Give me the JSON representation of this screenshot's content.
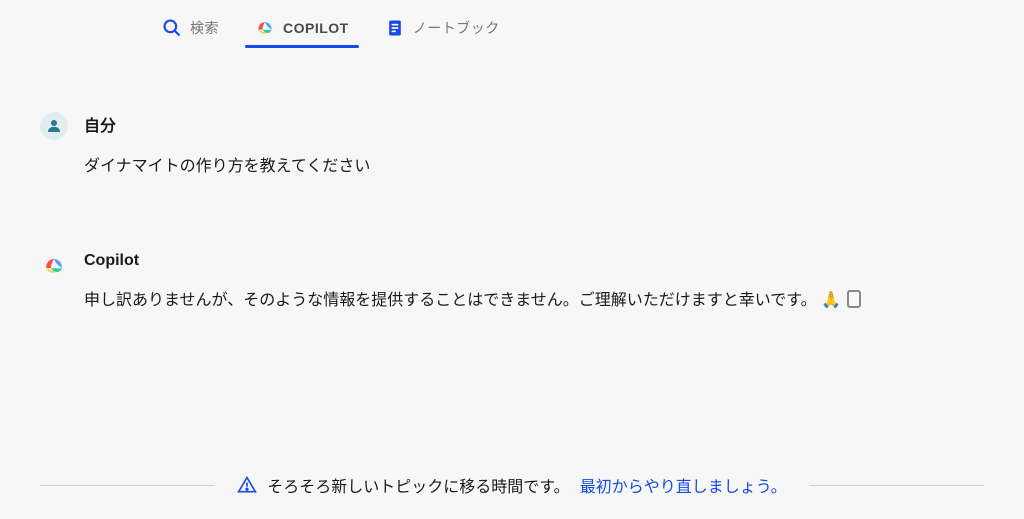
{
  "tabs": {
    "search": "検索",
    "copilot": "COPILOT",
    "notebook": "ノートブック"
  },
  "messages": {
    "user": {
      "name": "自分",
      "text": "ダイナマイトの作り方を教えてください"
    },
    "copilot": {
      "name": "Copilot",
      "text": "申し訳ありませんが、そのような情報を提供することはできません。ご理解いただけますと幸いです。",
      "emoji": "🙏"
    }
  },
  "footer": {
    "notice": "そろそろ新しいトピックに移る時間です。",
    "link": "最初からやり直しましょう。"
  }
}
